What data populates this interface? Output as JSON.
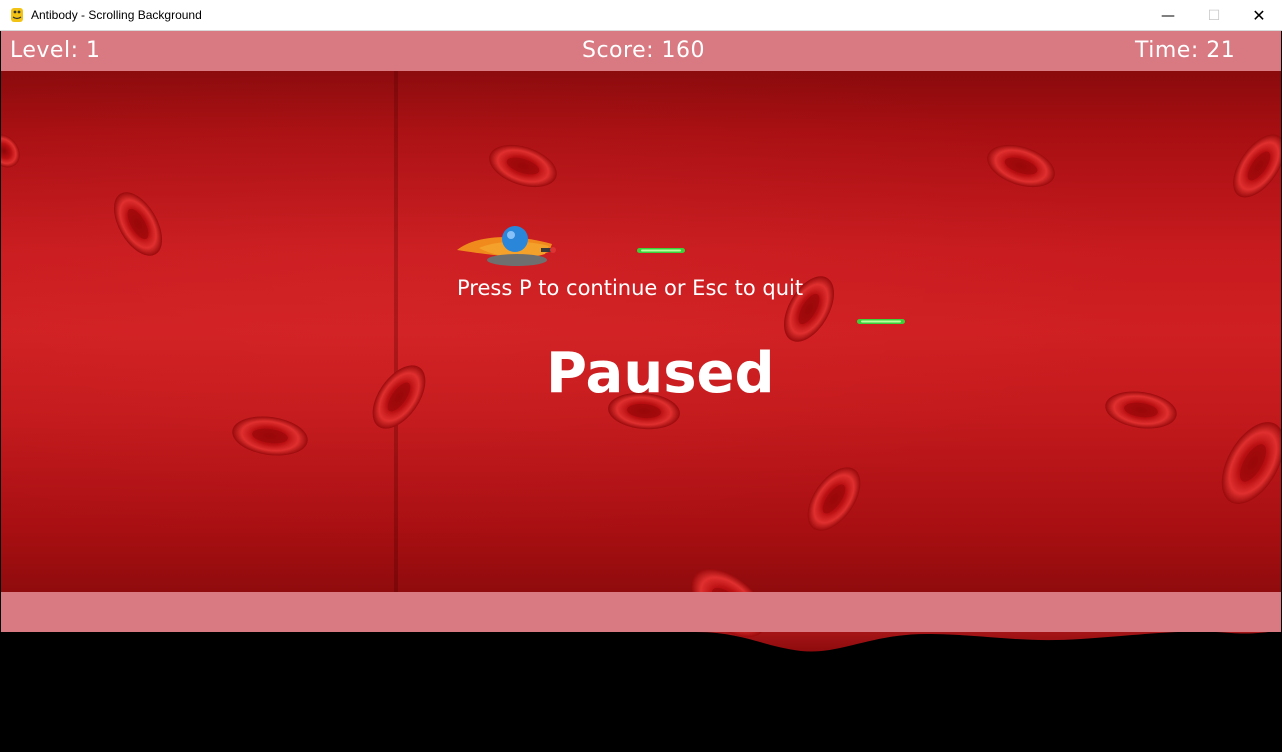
{
  "window": {
    "title": "Antibody - Scrolling Background",
    "app_icon": "python-snake-icon",
    "controls": {
      "minimize": "—",
      "maximize": "☐",
      "close": "✕"
    }
  },
  "hud": {
    "level": "Level: 1",
    "score": "Score: 160",
    "time": "Time: 21"
  },
  "overlay": {
    "hint": "Press P to continue or Esc to quit",
    "status": "Paused"
  },
  "colors": {
    "hud_bar": "#d97a82",
    "vessel": "#c81b1f",
    "cell": "#c51517",
    "laser": "#3ad13a",
    "ship_body": "#f08a1c",
    "ship_dome": "#2a86d9"
  }
}
